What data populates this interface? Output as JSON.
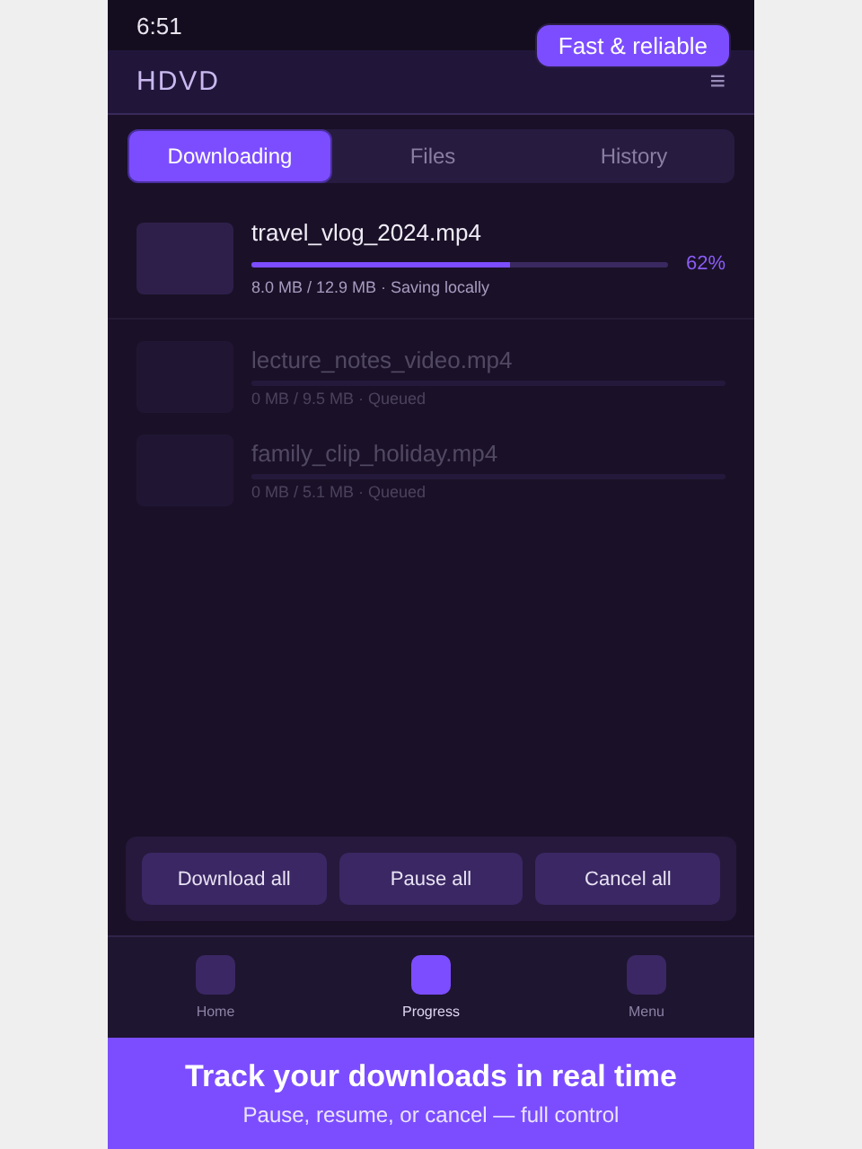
{
  "status_bar": {
    "time": "6:51"
  },
  "badge": "Fast & reliable",
  "app_bar": {
    "title": "HDVD",
    "menu_glyph": "≡"
  },
  "tabs": [
    {
      "label": "Downloading",
      "selected": true
    },
    {
      "label": "Files",
      "selected": false
    },
    {
      "label": "History",
      "selected": false
    }
  ],
  "downloads": [
    {
      "name": "travel_vlog_2024.mp4",
      "level": 0.62,
      "percent": "62%",
      "detail": "8.0 MB / 12.9 MB · Saving locally",
      "active": true
    },
    {
      "name": "lecture_notes_video.mp4",
      "detail": "0 MB / 9.5 MB · Queued",
      "active": false
    },
    {
      "name": "family_clip_holiday.mp4",
      "detail": "0 MB / 5.1 MB · Queued",
      "active": false
    }
  ],
  "actions": [
    "Download all",
    "Pause all",
    "Cancel all"
  ],
  "nav": [
    {
      "label": "Home",
      "selected": false
    },
    {
      "label": "Progress",
      "selected": true
    },
    {
      "label": "Menu",
      "selected": false
    }
  ],
  "banner": {
    "headline": "Track your downloads in real time",
    "subline": "Pause, resume, or cancel — full control"
  }
}
